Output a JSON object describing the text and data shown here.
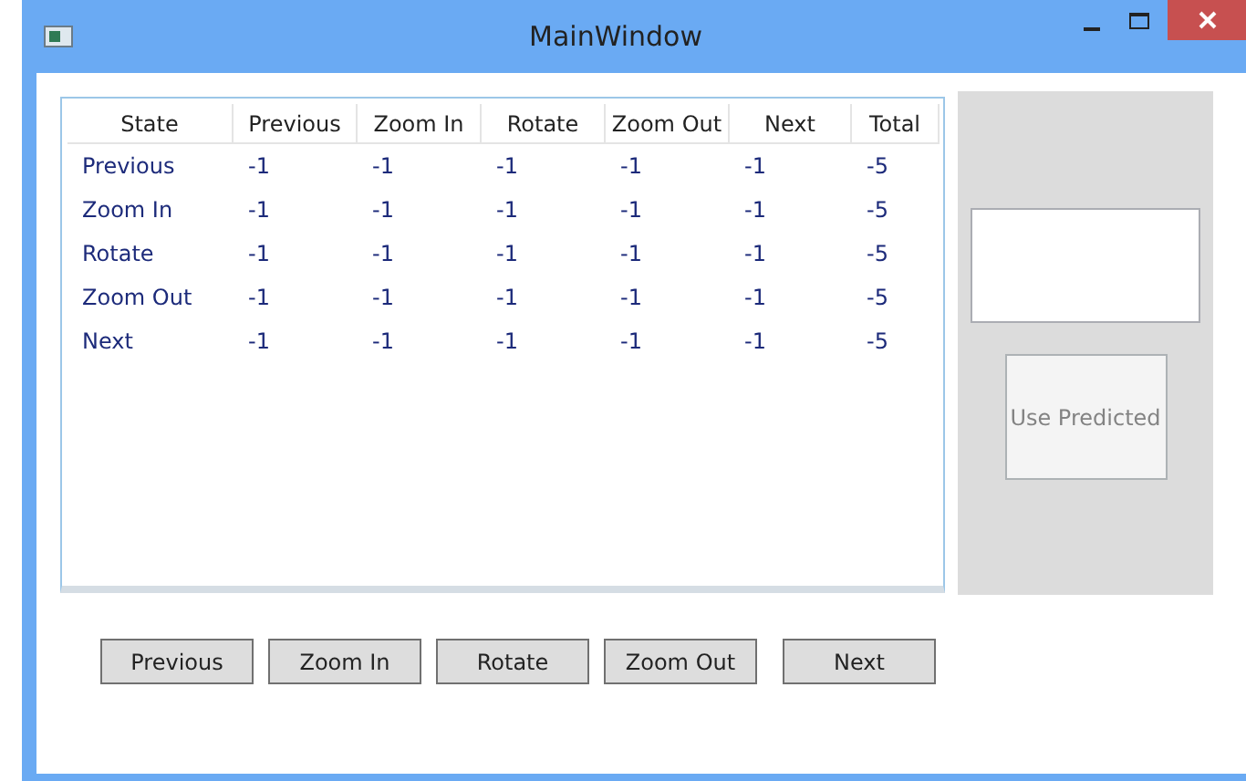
{
  "window": {
    "title": "MainWindow"
  },
  "table": {
    "columns": [
      "State",
      "Previous",
      "Zoom In",
      "Rotate",
      "Zoom Out",
      "Next",
      "Total"
    ],
    "rows": [
      [
        "Previous",
        "-1",
        "-1",
        "-1",
        "-1",
        "-1",
        "-5"
      ],
      [
        "Zoom In",
        "-1",
        "-1",
        "-1",
        "-1",
        "-1",
        "-5"
      ],
      [
        "Rotate",
        "-1",
        "-1",
        "-1",
        "-1",
        "-1",
        "-5"
      ],
      [
        "Zoom Out",
        "-1",
        "-1",
        "-1",
        "-1",
        "-1",
        "-5"
      ],
      [
        "Next",
        "-1",
        "-1",
        "-1",
        "-1",
        "-1",
        "-5"
      ]
    ]
  },
  "side_panel": {
    "button": {
      "label": "Use Predicted",
      "disabled": true
    }
  },
  "buttons": [
    "Previous",
    "Zoom In",
    "Rotate",
    "Zoom Out",
    "Next"
  ]
}
